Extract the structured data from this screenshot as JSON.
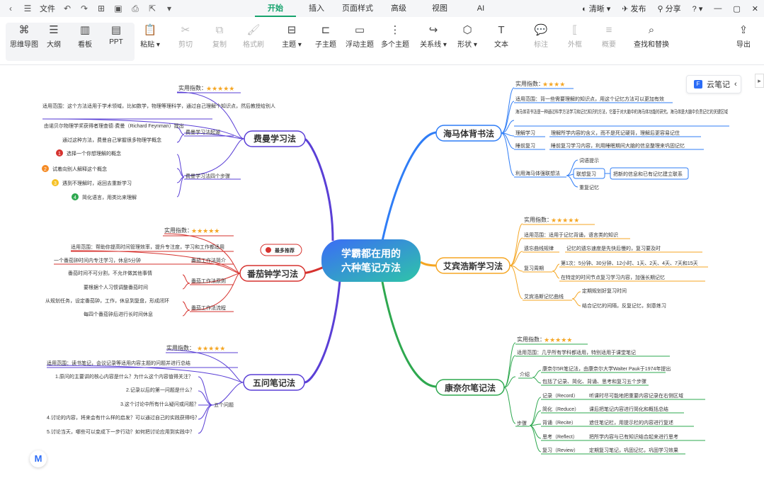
{
  "titlebar": {
    "file_label": "文件",
    "menu_tabs": [
      "开始",
      "插入",
      "页面样式",
      "高级",
      "视图",
      "AI"
    ],
    "active_tab": "开始",
    "share_status": "清晰",
    "publish": "发布",
    "share": "分享"
  },
  "toolbar": {
    "view_buttons": [
      "思维导图",
      "大纲",
      "看板",
      "PPT"
    ],
    "tools": [
      "粘贴",
      "剪切",
      "复制",
      "格式刷",
      "主题",
      "子主题",
      "浮动主题",
      "多个主题",
      "关系线",
      "形状",
      "文本",
      "标注",
      "外框",
      "概要",
      "查找和替换",
      "导出"
    ]
  },
  "cloud_notes": "云笔记",
  "mindmap": {
    "center": [
      "学霸都在用的",
      "六种笔记方法"
    ],
    "colors": {
      "center_from": "#3b6cf6",
      "center_to": "#2ec5a8",
      "blue": "#2f7df6",
      "purple": "#5a3fd6",
      "red": "#d6322e",
      "orange": "#f5a623",
      "green": "#2ea84f",
      "dark": "#333333"
    },
    "branches": {
      "feynman": {
        "title": "费曼学习法",
        "rating_label": "实用指数：",
        "scope_label": "适用范围：这个方法适用于学术领域，比如数学，物理等理科学，通过自己理解个知识点，然后教授给别人",
        "sub1": "费曼学习法起源",
        "sub1_items": [
          "由诺贝尔物理学奖获得者理查德·费曼（Richard Feynman）提出",
          "通过这种方法，费曼自己掌握很多物理学概念"
        ],
        "sub2": "费曼学习法四个步骤",
        "steps": [
          "选择一个你想理解的概念",
          "试着向别人解释这个概念",
          "遇到不理解时，返回去重新学习",
          "简化语言，用类比来理解"
        ]
      },
      "pomodoro": {
        "title": "番茄钟学习法",
        "badge": "最多推荐",
        "rating_label": "实用指数：",
        "scope_label": "适用范围：帮助你提高时间管理效率，提升专注度，学习和工作都适用",
        "sub1": "番茄工作法简介",
        "sub1_items": [
          "一个番茄钟时间内专注学习，休息5分钟"
        ],
        "sub2": "番茄工作法原则",
        "sub2_items": [
          "番茄时间不可分割，不允许做其他事情",
          "要根据个人习惯调整番茄时间"
        ],
        "sub3": "番茄工作法流程",
        "sub3_items": [
          "从规划任务，设定番茄钟，工作，休息到复盘，形成闭环",
          "每四个番茄钟后进行长时间休息"
        ]
      },
      "fiveq": {
        "title": "五问笔记法",
        "rating_label": "实用指数：",
        "scope_label": "适用范围：读书笔记，会议记录等适用内容主题的问题并进行总结",
        "sub1": "五个问题",
        "items": [
          "1.原问的主要讲的核心内容是什么？为什么这个内容值得关注？",
          "2.记录以后的第一问题是什么？",
          "3.这个讨论中所有什么疑问或问题？",
          "4.讨论的内容，将来会有什么样的启发？可以通过自己的实践获得吗？",
          "5.讨论当天，哪些可以变成下一步行动？如何把讨论应用到实践中？"
        ]
      },
      "hippocampus": {
        "title": "海马体背书法",
        "rating_label": "实用指数：",
        "scope_label": "适用范围：背一些需要理解的知识点，用这个记忆方法可以更加有效",
        "desc": "海马体背书法是一种通过科学方法学习和记忆知识的方法，它基于对大脑中的海马体功能的研究，海马体是大脑中负责记忆的关键区域",
        "sub1": "理解学习",
        "sub1_desc": "理解所学内容的含义，而不是死记硬背，理解后更容易记住",
        "sub2": "睡前复习",
        "sub2_desc": "睡前复习学习内容，利用睡眠期间大脑的信息整理来巩固记忆",
        "sub3": "利用海马体强联想法",
        "sub3_items": [
          "词语提示",
          "联想复习",
          "重复记忆"
        ],
        "sub3_note": "把新的信息和已有记忆建立联系"
      },
      "ebbinghaus": {
        "title": "艾宾浩斯学习法",
        "rating_label": "实用指数：",
        "scope_label": "适用范围：适用于记忆背诵，语言类的知识",
        "sub1": "遗忘曲线规律",
        "sub1_desc": "记忆的遗忘速度是先快后慢的，复习要及时",
        "sub2": "复习周期",
        "sub2_desc": "第1次：5分钟、30分钟、12小时、1天、2天、4天、7天和15天",
        "sub2_desc2": "在特定的时间节点复习学习内容，加强长期记忆",
        "sub3": "艾宾浩斯记忆曲线",
        "sub3_items": [
          "定期规划好复习时间",
          "结合记忆的间隔，反复记忆，刻意练习"
        ]
      },
      "cornell": {
        "title": "康奈尔笔记法",
        "rating_label": "实用指数：",
        "scope_label": "适用范围：几乎所有学科都适用，特别适用于课堂笔记",
        "sub1": "介绍",
        "sub1_items": [
          "康奈尔5R笔记法，由康奈尔大学Walter Pauk于1974年提出",
          "包括了记录、简化、背诵、思考和复习五个步骤"
        ],
        "sub2": "步骤",
        "steps": [
          {
            "name": "记录（Record）",
            "desc": "听课时尽可能地把重要内容记录在右侧区域"
          },
          {
            "name": "简化（Reduce）",
            "desc": "课后把笔记内容进行简化和概括总结"
          },
          {
            "name": "背诵（Recite）",
            "desc": "遮住笔记栏，用提示栏的内容进行复述"
          },
          {
            "name": "思考（Reflect）",
            "desc": "把所学内容与已有知识结合起来进行思考"
          },
          {
            "name": "复习（Review）",
            "desc": "定期复习笔记，巩固记忆，巩固学习效果"
          }
        ]
      }
    }
  }
}
